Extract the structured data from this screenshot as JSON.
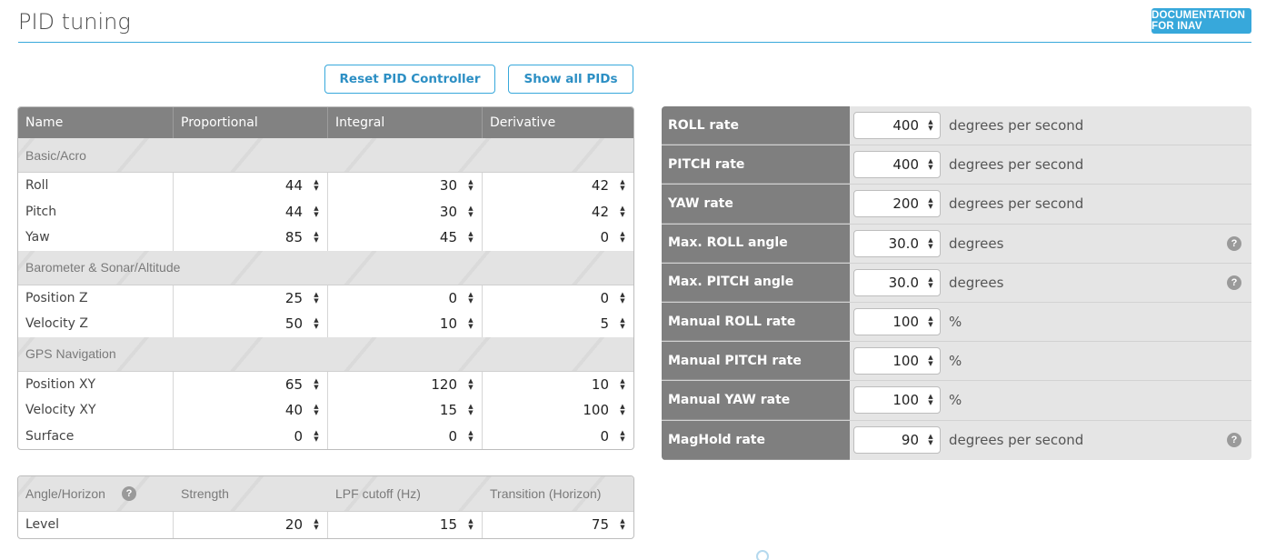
{
  "header": {
    "title": "PID tuning",
    "doc_button": "DOCUMENTATION FOR INAV"
  },
  "toolbar": {
    "reset_label": "Reset PID Controller",
    "showall_label": "Show all PIDs"
  },
  "pid_table": {
    "columns": [
      "Name",
      "Proportional",
      "Integral",
      "Derivative"
    ],
    "sections": [
      {
        "title": "Basic/Acro",
        "rows": [
          {
            "name": "Roll",
            "p": "44",
            "i": "30",
            "d": "42"
          },
          {
            "name": "Pitch",
            "p": "44",
            "i": "30",
            "d": "42"
          },
          {
            "name": "Yaw",
            "p": "85",
            "i": "45",
            "d": "0"
          }
        ]
      },
      {
        "title": "Barometer & Sonar/Altitude",
        "rows": [
          {
            "name": "Position Z",
            "p": "25",
            "i": "0",
            "d": "0"
          },
          {
            "name": "Velocity Z",
            "p": "50",
            "i": "10",
            "d": "5"
          }
        ]
      },
      {
        "title": "GPS Navigation",
        "rows": [
          {
            "name": "Position XY",
            "p": "65",
            "i": "120",
            "d": "10"
          },
          {
            "name": "Velocity XY",
            "p": "40",
            "i": "15",
            "d": "100"
          },
          {
            "name": "Surface",
            "p": "0",
            "i": "0",
            "d": "0"
          }
        ]
      }
    ]
  },
  "angle_table": {
    "columns": [
      "Angle/Horizon",
      "Strength",
      "LPF cutoff (Hz)",
      "Transition (Horizon)"
    ],
    "rows": [
      {
        "name": "Level",
        "strength": "20",
        "lpf": "15",
        "transition": "75"
      }
    ]
  },
  "rates": [
    {
      "label": "ROLL rate",
      "value": "400",
      "unit": "degrees per second",
      "help": false
    },
    {
      "label": "PITCH rate",
      "value": "400",
      "unit": "degrees per second",
      "help": false
    },
    {
      "label": "YAW rate",
      "value": "200",
      "unit": "degrees per second",
      "help": false
    },
    {
      "label": "Max. ROLL angle",
      "value": "30.0",
      "unit": "degrees",
      "help": true
    },
    {
      "label": "Max. PITCH angle",
      "value": "30.0",
      "unit": "degrees",
      "help": true
    },
    {
      "label": "Manual ROLL rate",
      "value": "100",
      "unit": "%",
      "help": false
    },
    {
      "label": "Manual PITCH rate",
      "value": "100",
      "unit": "%",
      "help": false
    },
    {
      "label": "Manual YAW rate",
      "value": "100",
      "unit": "%",
      "help": false
    },
    {
      "label": "MagHold rate",
      "value": "90",
      "unit": "degrees per second",
      "help": true
    }
  ],
  "icons": {
    "help": "?",
    "spin_up": "▲",
    "spin_down": "▼"
  },
  "colors": {
    "accent": "#37a8db",
    "header_gray": "#828282",
    "rate_label_gray": "#7f7f7f"
  }
}
